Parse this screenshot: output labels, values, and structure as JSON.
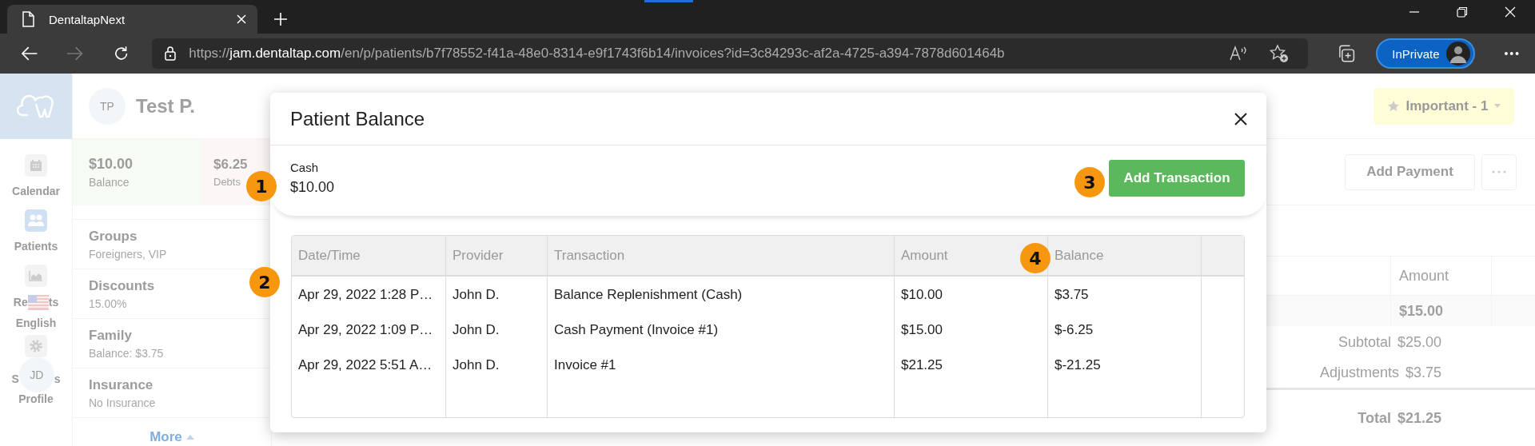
{
  "browser": {
    "tab_title": "DentaltapNext",
    "url": {
      "scheme": "https://",
      "host": "jam.dentaltap.com",
      "rest": "/en/p/patients/b7f78552-f41a-48e0-8314-e9f1743f6b14/invoices?id=3c84293c-af2a-4725-a394-7878d601464b"
    },
    "forward_disabled": true,
    "profile_label": "InPrivate"
  },
  "nav": {
    "items": [
      {
        "kind": "plain",
        "label": "Calendar",
        "selected": false
      },
      {
        "kind": "plain",
        "label": "Patients",
        "selected": true
      },
      {
        "kind": "split",
        "label_start": "Re",
        "label_end": "ts",
        "selected": false
      }
    ],
    "language": "English",
    "settings": {
      "label_start": "S",
      "label_end": "s"
    },
    "profile": {
      "initials": "JD",
      "label": "Profile"
    }
  },
  "patient": {
    "initials": "TP",
    "name": "Test P.",
    "stats": [
      {
        "kind": "positive",
        "value": "$10.00",
        "label": "Balance"
      },
      {
        "kind": "negative",
        "value": "$6.25",
        "label": "Debts"
      }
    ],
    "details": [
      {
        "title": "Groups",
        "value": "Foreigners, VIP"
      },
      {
        "title": "Discounts",
        "value": "15.00%"
      },
      {
        "title": "Family",
        "value": "Balance: $3.75"
      },
      {
        "title": "Insurance",
        "value": "No Insurance"
      }
    ],
    "more_link": "More"
  },
  "header_actions": {
    "important": "Important - 1",
    "add_payment": "Add Payment"
  },
  "invoice": {
    "columns": [
      "Amount"
    ],
    "rows": [
      [
        "$15.00"
      ]
    ],
    "totals": [
      {
        "kind": "sub",
        "label": "Subtotal",
        "value": "$25.00"
      },
      {
        "kind": "sub",
        "label": "Adjustments",
        "value": "$3.75"
      },
      {
        "kind": "grand",
        "label": "Total",
        "value": "$21.25"
      }
    ]
  },
  "modal": {
    "title": "Patient Balance",
    "account": {
      "label": "Cash",
      "amount": "$10.00"
    },
    "add_button": "Add Transaction",
    "table": {
      "columns": [
        "Date/Time",
        "Provider",
        "Transaction",
        "Amount",
        "Balance"
      ],
      "rows": [
        [
          "Apr 29, 2022 1:28 P…",
          "John D.",
          "Balance Replenishment (Cash)",
          "$10.00",
          "$3.75"
        ],
        [
          "Apr 29, 2022 1:09 P…",
          "John D.",
          "Cash Payment (Invoice #1)",
          "$15.00",
          "$-6.25"
        ],
        [
          "Apr 29, 2022 5:51 A…",
          "John D.",
          "Invoice #1",
          "$21.25",
          "$-21.25"
        ]
      ]
    }
  },
  "callouts": [
    "1",
    "2",
    "3",
    "4"
  ]
}
